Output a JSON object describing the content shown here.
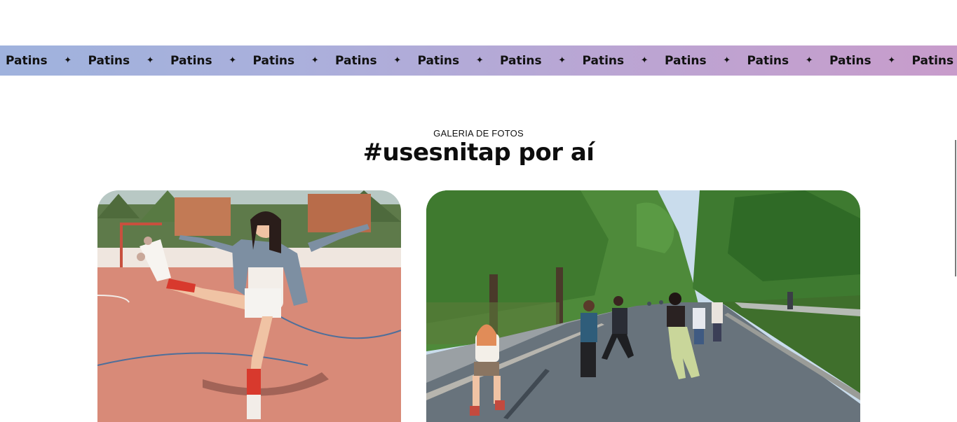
{
  "marquee": {
    "word": "Patins",
    "separator_icon": "four-point-star-icon",
    "items": [
      "Patins",
      "Patins",
      "Patins",
      "Patins",
      "Patins",
      "Patins",
      "Patins",
      "Patins",
      "Patins",
      "Patins",
      "Patins",
      "Patins"
    ]
  },
  "gallery": {
    "eyebrow": "GALERIA DE FOTOS",
    "title": "#usesnitap por aí",
    "photos": [
      {
        "subject": "skater-court-photo"
      },
      {
        "subject": "skaters-park-photo"
      }
    ]
  },
  "colors": {
    "marquee_start": "#9fb2dd",
    "marquee_end": "#c89ccb",
    "text": "#0d0d0d"
  }
}
